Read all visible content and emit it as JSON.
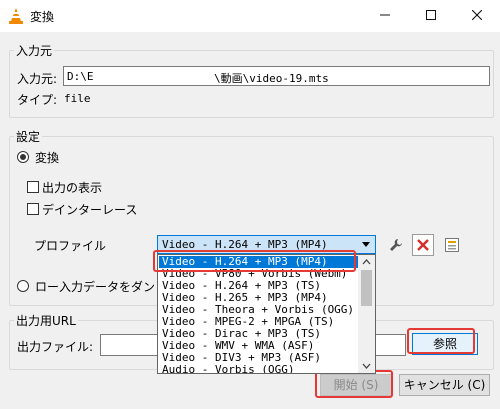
{
  "window": {
    "title": "変換"
  },
  "source": {
    "group_label": "入力元",
    "input_label": "入力元:",
    "path_start": "D:\\E",
    "path_end": "\\動画\\video-19.mts",
    "type_label": "タイプ:",
    "type_value": "file"
  },
  "settings": {
    "group_label": "設定",
    "convert_radio_label": "変換",
    "show_output_label": "出力の表示",
    "deinterlace_label": "デインターレース",
    "profile_label": "プロファイル",
    "profile_selected": "Video - H.264 + MP3 (MP4)",
    "dump_raw_label": "ロー入力データをダン"
  },
  "profile_options": [
    "Video - H.264 + MP3 (MP4)",
    "Video - VP80 + Vorbis (Webm)",
    "Video - H.264 + MP3 (TS)",
    "Video - H.265 + MP3 (MP4)",
    "Video - Theora + Vorbis (OGG)",
    "Video - MPEG-2 + MPGA (TS)",
    "Video - Dirac + MP3 (TS)",
    "Video - WMV + WMA (ASF)",
    "Video - DIV3 + MP3 (ASF)",
    "Audio - Vorbis (OGG)"
  ],
  "destination": {
    "group_label": "出力用URL",
    "file_label": "出力ファイル:",
    "browse_label": "参照"
  },
  "footer": {
    "start_label": "開始 (S)",
    "cancel_label": "キャンセル (C)"
  },
  "colors": {
    "highlight": "#e53935",
    "selection": "#0078d7"
  }
}
